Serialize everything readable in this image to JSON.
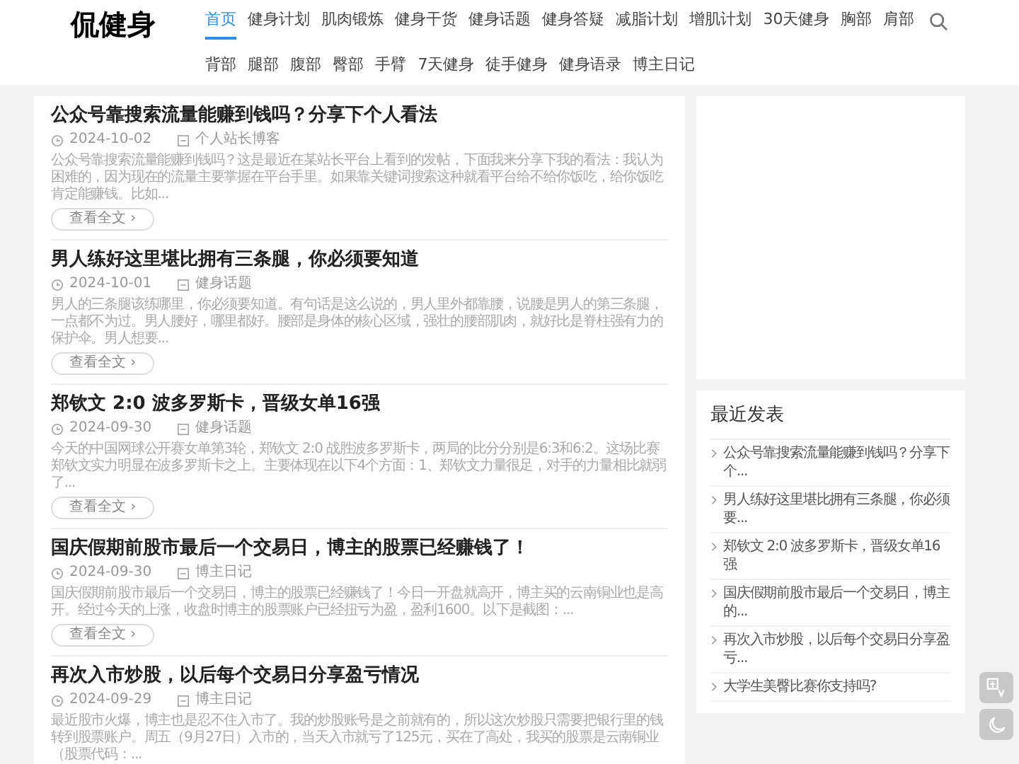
{
  "site": {
    "logo": "侃健身"
  },
  "nav": [
    {
      "label": "首页",
      "selected": true
    },
    {
      "label": "健身计划",
      "selected": false
    },
    {
      "label": "肌肉锻炼",
      "selected": false
    },
    {
      "label": "健身干货",
      "selected": false
    },
    {
      "label": "健身话题",
      "selected": false
    },
    {
      "label": "健身答疑",
      "selected": false
    },
    {
      "label": "减脂计划",
      "selected": false
    },
    {
      "label": "增肌计划",
      "selected": false
    },
    {
      "label": "30天健身",
      "selected": false
    },
    {
      "label": "胸部",
      "selected": false
    },
    {
      "label": "肩部",
      "selected": false
    },
    {
      "label": "背部",
      "selected": false
    },
    {
      "label": "腿部",
      "selected": false
    },
    {
      "label": "腹部",
      "selected": false
    },
    {
      "label": "臀部",
      "selected": false
    },
    {
      "label": "手臂",
      "selected": false
    },
    {
      "label": "7天健身",
      "selected": false
    },
    {
      "label": "徒手健身",
      "selected": false
    },
    {
      "label": "健身语录",
      "selected": false
    },
    {
      "label": "博主日记",
      "selected": false
    }
  ],
  "posts": [
    {
      "title": "公众号靠搜索流量能赚到钱吗？分享下个人看法",
      "date": "2024-10-02",
      "category": "个人站长博客",
      "excerpt": "公众号靠搜索流量能赚到钱吗？这是最近在某站长平台上看到的发帖，下面我来分享下我的看法：我认为困难的，因为现在的流量主要掌握在平台手里。如果靠关键词搜索这种就看平台给不给你饭吃，给你饭吃肯定能赚钱。比如...",
      "button": "查看全文 ›"
    },
    {
      "title": "男人练好这里堪比拥有三条腿，你必须要知道",
      "date": "2024-10-01",
      "category": "健身话题",
      "excerpt": "男人的三条腿该练哪里，你必须要知道。有句话是这么说的，男人里外都靠腰，说腰是男人的第三条腿，一点都不为过。男人腰好，哪里都好。腰部是身体的核心区域，强壮的腰部肌肉，就好比是脊柱强有力的保护伞。男人想要...",
      "button": "查看全文 ›"
    },
    {
      "title": "郑钦文 2:0 波多罗斯卡，晋级女单16强",
      "date": "2024-09-30",
      "category": "健身话题",
      "excerpt": "今天的中国网球公开赛女单第3轮，郑钦文 2:0 战胜波多罗斯卡，两局的比分分别是6:3和6:2。这场比赛郑钦文实力明显在波多罗斯卡之上。主要体现在以下4个方面：1、郑钦文力量很足，对手的力量相比就弱了...",
      "button": "查看全文 ›"
    },
    {
      "title": "国庆假期前股市最后一个交易日，博主的股票已经赚钱了！",
      "date": "2024-09-30",
      "category": "博主日记",
      "excerpt": "国庆假期前股市最后一个交易日，博主的股票已经赚钱了！今日一开盘就高开，博主买的云南铜业也是高开。经过今天的上涨，收盘时博主的股票账户已经扭亏为盈，盈利1600。以下是截图：...",
      "button": "查看全文 ›"
    },
    {
      "title": "再次入市炒股，以后每个交易日分享盈亏情况",
      "date": "2024-09-29",
      "category": "博主日记",
      "excerpt": "最近股市火爆，博主也是忍不住入市了。我的炒股账号是之前就有的，所以这次炒股只需要把银行里的钱转到股票账户。周五（9月27日）入市的，当天入市就亏了125元，买在了高处，我买的股票是云南铜业（股票代码：..."
    }
  ],
  "sidebar": {
    "recent_title": "最近发表",
    "recent": [
      "公众号靠搜索流量能赚到钱吗？分享下个...",
      "男人练好这里堪比拥有三条腿，你必须要...",
      "郑钦文 2:0 波多罗斯卡，晋级女单16强",
      "国庆假期前股市最后一个交易日，博主的...",
      "再次入市炒股，以后每个交易日分享盈亏...",
      "大学生美臀比赛你支持吗?"
    ]
  }
}
